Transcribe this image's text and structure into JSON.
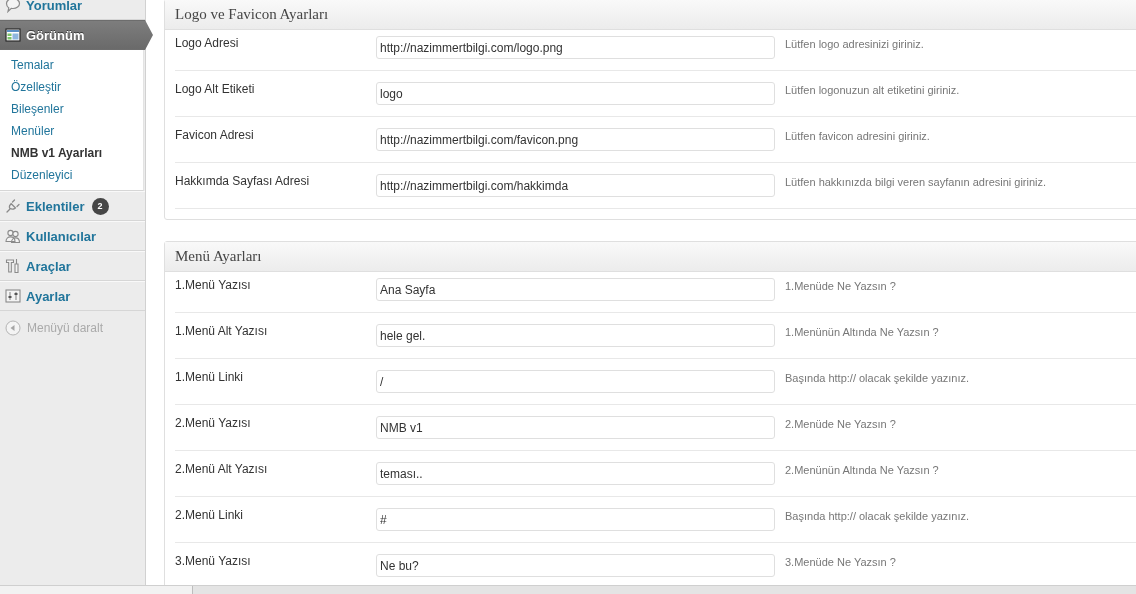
{
  "sidebar": {
    "items": [
      {
        "label": "Yorumlar",
        "selected": false
      },
      {
        "label": "Görünüm",
        "selected": true,
        "children": [
          {
            "label": "Temalar",
            "selected": false
          },
          {
            "label": "Özelleştir",
            "selected": false
          },
          {
            "label": "Bileşenler",
            "selected": false
          },
          {
            "label": "Menüler",
            "selected": false
          },
          {
            "label": "NMB v1 Ayarları",
            "selected": true
          },
          {
            "label": "Düzenleyici",
            "selected": false
          }
        ]
      },
      {
        "label": "Eklentiler",
        "selected": false,
        "badge": "2"
      },
      {
        "label": "Kullanıcılar",
        "selected": false
      },
      {
        "label": "Araçlar",
        "selected": false
      },
      {
        "label": "Ayarlar",
        "selected": false
      }
    ],
    "collapse": {
      "label": "Menüyü daralt"
    }
  },
  "panels": [
    {
      "title": "Logo ve Favicon Ayarları",
      "rows": [
        {
          "label": "Logo Adresi",
          "value": "http://nazimmertbilgi.com/logo.png",
          "help": "Lütfen logo adresinizi giriniz."
        },
        {
          "label": "Logo Alt Etiketi",
          "value": "logo",
          "help": "Lütfen logonuzun alt etiketini giriniz."
        },
        {
          "label": "Favicon Adresi",
          "value": "http://nazimmertbilgi.com/favicon.png",
          "help": "Lütfen favicon adresini giriniz."
        },
        {
          "label": "Hakkımda Sayfası Adresi",
          "value": "http://nazimmertbilgi.com/hakkimda",
          "help": "Lütfen hakkınızda bilgi veren sayfanın adresini giriniz."
        }
      ]
    },
    {
      "title": "Menü Ayarları",
      "rows": [
        {
          "label": "1.Menü Yazısı",
          "value": "Ana Sayfa",
          "help": "1.Menüde Ne Yazsın ?"
        },
        {
          "label": "1.Menü Alt Yazısı",
          "value": "hele gel.",
          "help": "1.Menünün Altında Ne Yazsın ?"
        },
        {
          "label": "1.Menü Linki",
          "value": "/",
          "help": "Başında http:// olacak şekilde yazınız."
        },
        {
          "label": "2.Menü Yazısı",
          "value": "NMB v1",
          "help": "2.Menüde Ne Yazsın ?"
        },
        {
          "label": "2.Menü Alt Yazısı",
          "value": "teması..",
          "help": "2.Menünün Altında Ne Yazsın ?"
        },
        {
          "label": "2.Menü Linki",
          "value": "#",
          "help": "Başında http:// olacak şekilde yazınız."
        },
        {
          "label": "3.Menü Yazısı",
          "value": "Ne bu?",
          "help": "3.Menüde Ne Yazsın ?"
        }
      ]
    }
  ]
}
